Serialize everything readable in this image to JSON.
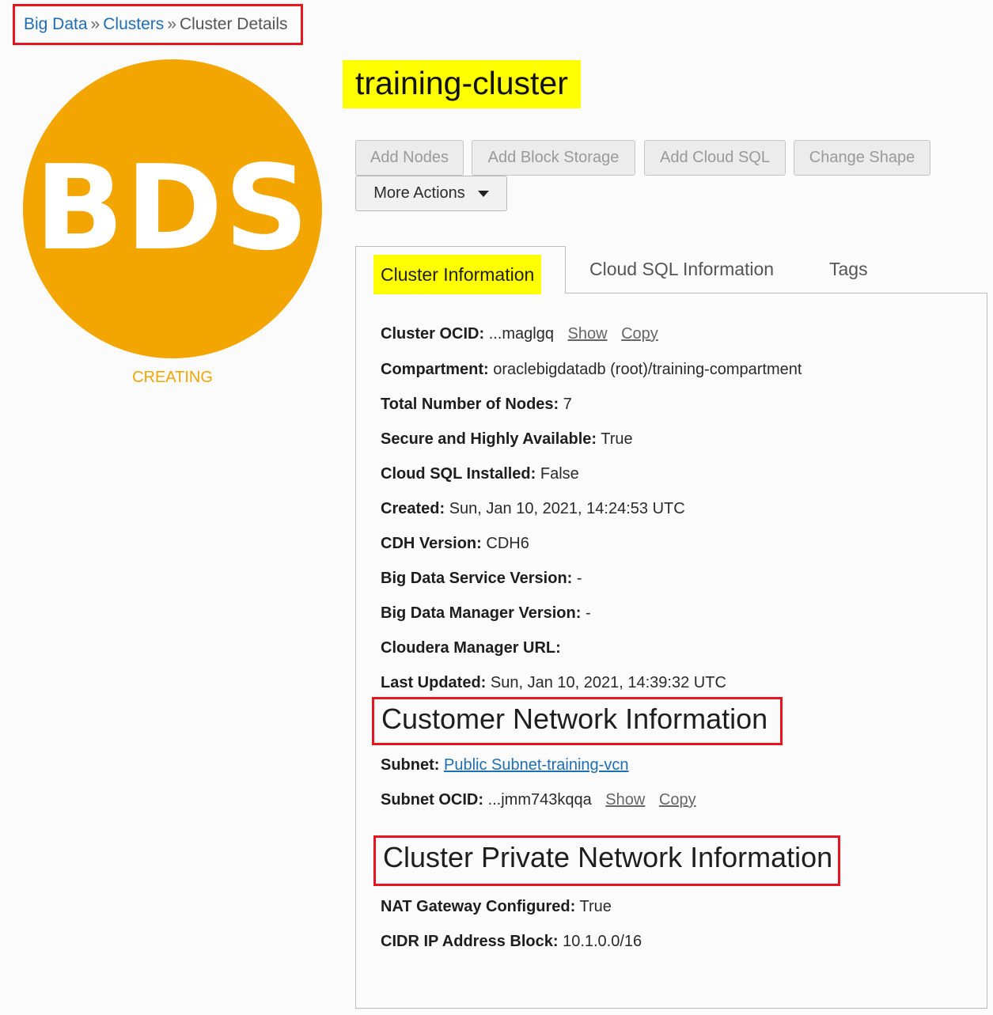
{
  "breadcrumb": {
    "items": [
      "Big Data",
      "Clusters"
    ],
    "current": "Cluster Details",
    "separator": "»"
  },
  "logo": {
    "text": "BDS",
    "color": "#f3a502"
  },
  "status": "CREATING",
  "cluster_name": "training-cluster",
  "actions": {
    "add_nodes": "Add Nodes",
    "add_block_storage": "Add Block Storage",
    "add_cloud_sql": "Add Cloud SQL",
    "change_shape": "Change Shape",
    "more_actions": "More Actions"
  },
  "tabs": [
    "Cluster Information",
    "Cloud SQL Information",
    "Tags"
  ],
  "cluster_info": {
    "ocid_label": "Cluster OCID:",
    "ocid_value": "...maglgq",
    "show": "Show",
    "copy": "Copy",
    "compartment_label": "Compartment:",
    "compartment_value": "oraclebigdatadb (root)/training-compartment",
    "nodes_label": "Total Number of Nodes:",
    "nodes_value": "7",
    "secure_label": "Secure and Highly Available:",
    "secure_value": "True",
    "cloudsql_label": "Cloud SQL Installed:",
    "cloudsql_value": "False",
    "created_label": "Created:",
    "created_value": "Sun, Jan 10, 2021, 14:24:53 UTC",
    "cdh_label": "CDH Version:",
    "cdh_value": "CDH6",
    "bds_version_label": "Big Data Service Version:",
    "bds_version_value": "-",
    "bdm_version_label": "Big Data Manager Version:",
    "bdm_version_value": "-",
    "cm_url_label": "Cloudera Manager URL:",
    "cm_url_value": "",
    "updated_label": "Last Updated:",
    "updated_value": "Sun, Jan 10, 2021, 14:39:32 UTC"
  },
  "customer_network": {
    "heading": "Customer Network Information",
    "subnet_label": "Subnet:",
    "subnet_value": "Public Subnet-training-vcn",
    "subnet_ocid_label": "Subnet OCID:",
    "subnet_ocid_value": "...jmm743kqqa",
    "show": "Show",
    "copy": "Copy"
  },
  "private_network": {
    "heading": "Cluster Private Network Information",
    "nat_label": "NAT Gateway Configured:",
    "nat_value": "True",
    "cidr_label": "CIDR IP Address Block:",
    "cidr_value": "10.1.0.0/16"
  }
}
